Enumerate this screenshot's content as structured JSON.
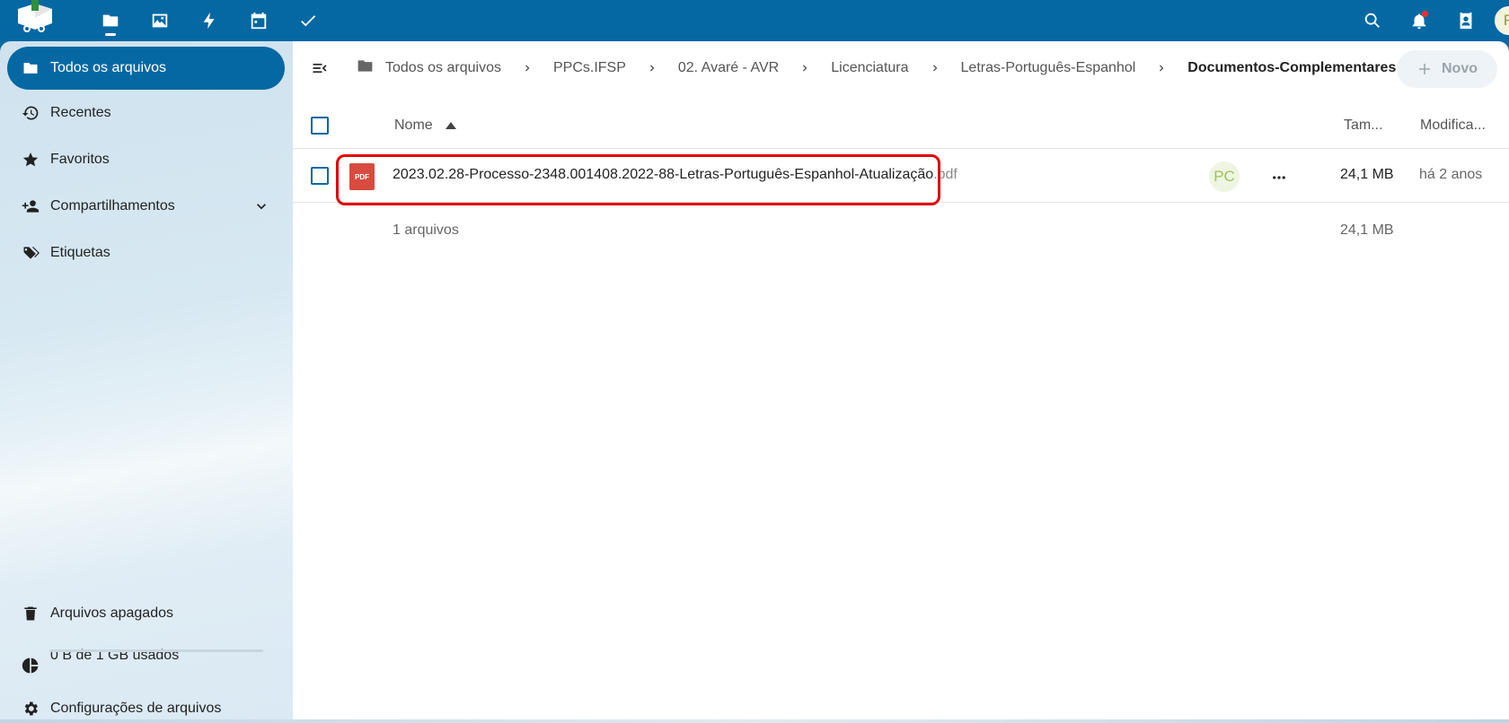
{
  "header": {
    "apps": [
      {
        "name": "files",
        "active": true
      },
      {
        "name": "photos",
        "active": false
      },
      {
        "name": "activity",
        "active": false
      },
      {
        "name": "calendar",
        "active": false
      },
      {
        "name": "tasks",
        "active": false
      }
    ],
    "user_initial": "R"
  },
  "sidebar": {
    "items": [
      {
        "label": "Todos os arquivos",
        "icon": "folder-icon",
        "active": true
      },
      {
        "label": "Recentes",
        "icon": "history-icon"
      },
      {
        "label": "Favoritos",
        "icon": "star-icon"
      },
      {
        "label": "Compartilhamentos",
        "icon": "share-user-icon"
      },
      {
        "label": "Etiquetas",
        "icon": "tag-icon"
      }
    ],
    "trash_label": "Arquivos apagados",
    "quota_label": "0 B de 1 GB usados",
    "quota_fraction": 0.0,
    "settings_label": "Configurações de arquivos"
  },
  "breadcrumb": {
    "items": [
      "Todos os arquivos",
      "PPCs.IFSP",
      "02. Avaré - AVR",
      "Licenciatura",
      "Letras-Português-Espanhol"
    ],
    "current": "Documentos-Complementares"
  },
  "new_button_label": "Novo",
  "table": {
    "col_name": "Nome",
    "col_size": "Tam...",
    "col_modified": "Modifica...",
    "rows": [
      {
        "name": "2023.02.28-Processo-2348.001408.2022-88-Letras-Português-Espanhol-Atualização",
        "ext": ".pdf",
        "icon_text": "PDF",
        "share_initials": "PC",
        "size": "24,1 MB",
        "modified": "há 2 anos"
      }
    ],
    "summary_count": "1 arquivos",
    "summary_size": "24,1 MB"
  },
  "colors": {
    "accent": "#0568a3",
    "highlight": "#e00000",
    "pdf": "#d84b3f"
  }
}
